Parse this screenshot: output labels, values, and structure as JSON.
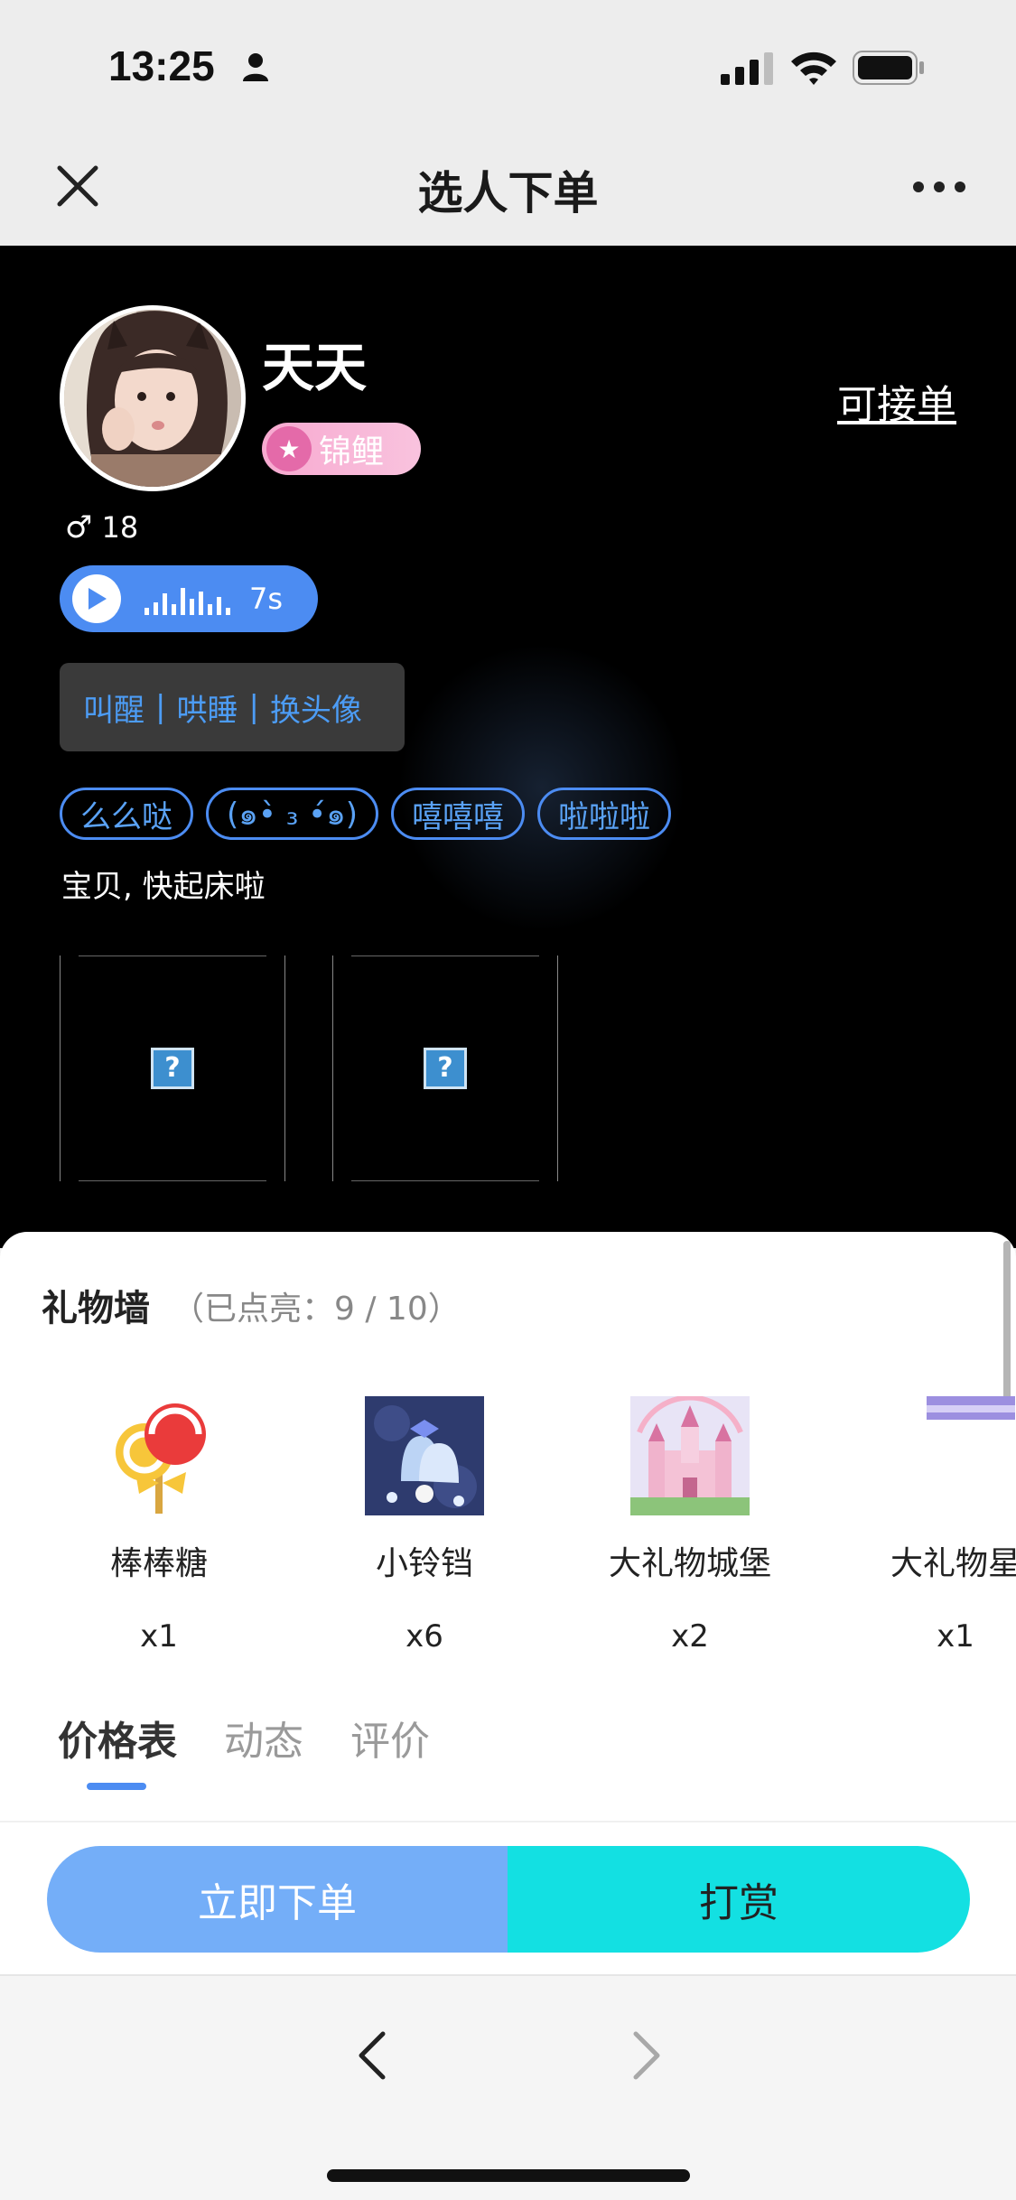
{
  "status_bar": {
    "time": "13:25",
    "icons": [
      "person-icon",
      "signal-icon",
      "wifi-icon",
      "battery-icon"
    ]
  },
  "nav": {
    "title": "选人下单",
    "left_icon": "close-icon",
    "right_icon": "more-icon"
  },
  "profile": {
    "nickname": "天天",
    "level_label": "锦鲤",
    "status_link": "可接单",
    "gender_symbol": "♂",
    "age": "18",
    "voice_duration": "7s",
    "services": [
      "叫醒",
      "哄睡",
      "换头像"
    ],
    "tags": [
      "么么哒",
      "(๑•̀ ₃ •́๑)",
      "嘻嘻嘻",
      "啦啦啦"
    ],
    "bio": "宝贝, 快起床啦",
    "photo_placeholder": "?"
  },
  "gift_wall": {
    "title": "礼物墙",
    "count_text": "（已点亮：9 / 10）",
    "gifts": [
      {
        "name": "棒棒糖",
        "qty": "x1"
      },
      {
        "name": "小铃铛",
        "qty": "x6"
      },
      {
        "name": "大礼物城堡",
        "qty": "x2"
      },
      {
        "name": "大礼物星",
        "qty": "x1"
      }
    ]
  },
  "tabs": [
    "价格表",
    "动态",
    "评价"
  ],
  "actions": {
    "order_label": "立即下单",
    "tip_label": "打赏"
  },
  "colors": {
    "accent_blue": "#4c8cf2",
    "order_button": "#74aef8",
    "tip_button": "#13e0e2",
    "badge_pink": "#f7a9d0"
  }
}
